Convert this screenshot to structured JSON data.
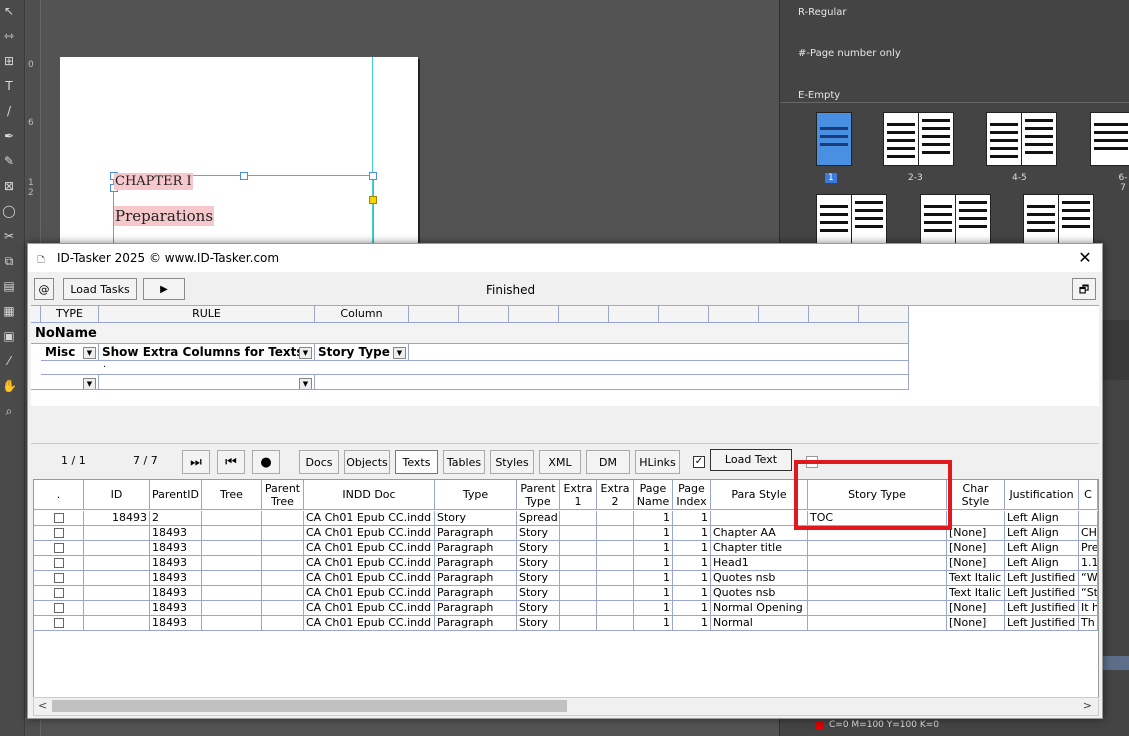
{
  "indesign": {
    "page_text": {
      "chapter": "CHAPTER I",
      "preparations": "Preparations"
    },
    "ruler_marks": [
      "0",
      "6",
      "1",
      "2"
    ],
    "pages_panel": {
      "masters": [
        "R-Regular",
        "#-Page number only",
        "E-Empty"
      ],
      "page_labels": [
        "1",
        "2-3",
        "4-5",
        "6-7"
      ]
    },
    "swatch": "C=0 M=100 Y=100 K=0",
    "tool_icons": [
      "selection-icon",
      "gap-icon",
      "page-tool-icon",
      "type-icon",
      "line-icon",
      "pen-icon",
      "pencil-icon",
      "frame-icon",
      "shape-icon",
      "scissors-icon",
      "transform-icon",
      "gradient-icon",
      "gradient-feather-icon",
      "note-icon",
      "eyedropper-icon",
      "hand-icon",
      "zoom-icon"
    ]
  },
  "dialog": {
    "title": "ID-Tasker 2025  © www.ID-Tasker.com",
    "close_glyph": "✕",
    "at_label": "@",
    "load_tasks_label": "Load Tasks",
    "run_glyph": "▶",
    "status": "Finished",
    "restore_glyph": "🗗",
    "rules": {
      "headers": [
        "TYPE",
        "RULE",
        "Column"
      ],
      "group": "NoName",
      "row1": {
        "type": "Misc",
        "rule": "Show Extra Columns for Texts",
        "column": "Story Type"
      },
      "row1_sub": "."
    },
    "toolbar": {
      "page_count": "1 / 1",
      "item_count": "7 / 7",
      "last_glyph": "⏭",
      "first_glyph": "⏮",
      "record_glyph": "●",
      "tabs": [
        "Docs",
        "Objects",
        "Texts",
        "Tables",
        "Styles",
        "XML",
        "DM",
        "HLinks"
      ],
      "active_tab": "Texts",
      "load_text_label": "Load Text",
      "checkbox_checked": "✓"
    },
    "grid": {
      "headers": [
        ".",
        "ID",
        "ParentID",
        "Tree",
        "Parent\nTree",
        "INDD Doc",
        "Type",
        "Parent\nType",
        "Extra\n1",
        "Extra\n2",
        "Page\nName",
        "Page\nIndex",
        "Para Style",
        "Story Type",
        "Char\nStyle",
        "Justification",
        "C"
      ],
      "rows": [
        {
          "id": "18493",
          "parent_id": "2",
          "doc": "CA Ch01 Epub CC.indd",
          "type": "Story",
          "parent_type": "Spread",
          "page_name": "1",
          "page_index": "1",
          "para_style": "",
          "story_type": "TOC",
          "char_style": "",
          "justification": "Left Align",
          "c": ""
        },
        {
          "id": "",
          "parent_id": "18493",
          "doc": "CA Ch01 Epub CC.indd",
          "type": "Paragraph",
          "parent_type": "Story",
          "page_name": "1",
          "page_index": "1",
          "para_style": "Chapter AA",
          "story_type": "",
          "char_style": "[None]",
          "justification": "Left Align",
          "c": "CH"
        },
        {
          "id": "",
          "parent_id": "18493",
          "doc": "CA Ch01 Epub CC.indd",
          "type": "Paragraph",
          "parent_type": "Story",
          "page_name": "1",
          "page_index": "1",
          "para_style": "Chapter title",
          "story_type": "",
          "char_style": "[None]",
          "justification": "Left Align",
          "c": "Pre"
        },
        {
          "id": "",
          "parent_id": "18493",
          "doc": "CA Ch01 Epub CC.indd",
          "type": "Paragraph",
          "parent_type": "Story",
          "page_name": "1",
          "page_index": "1",
          "para_style": "Head1",
          "story_type": "",
          "char_style": "[None]",
          "justification": "Left Align",
          "c": "1.1"
        },
        {
          "id": "",
          "parent_id": "18493",
          "doc": "CA Ch01 Epub CC.indd",
          "type": "Paragraph",
          "parent_type": "Story",
          "page_name": "1",
          "page_index": "1",
          "para_style": "Quotes nsb",
          "story_type": "",
          "char_style": "Text Italic",
          "justification": "Left Justified",
          "c": "“Wl"
        },
        {
          "id": "",
          "parent_id": "18493",
          "doc": "CA Ch01 Epub CC.indd",
          "type": "Paragraph",
          "parent_type": "Story",
          "page_name": "1",
          "page_index": "1",
          "para_style": "Quotes nsb",
          "story_type": "",
          "char_style": "Text Italic",
          "justification": "Left Justified",
          "c": "“St"
        },
        {
          "id": "",
          "parent_id": "18493",
          "doc": "CA Ch01 Epub CC.indd",
          "type": "Paragraph",
          "parent_type": "Story",
          "page_name": "1",
          "page_index": "1",
          "para_style": "Normal Opening",
          "story_type": "",
          "char_style": "[None]",
          "justification": "Left Justified",
          "c": "It h"
        },
        {
          "id": "",
          "parent_id": "18493",
          "doc": "CA Ch01 Epub CC.indd",
          "type": "Paragraph",
          "parent_type": "Story",
          "page_name": "1",
          "page_index": "1",
          "para_style": "Normal",
          "story_type": "",
          "char_style": "[None]",
          "justification": "Left Justified",
          "c": "Th"
        }
      ]
    },
    "scroll_left": "<",
    "scroll_right": ">"
  }
}
